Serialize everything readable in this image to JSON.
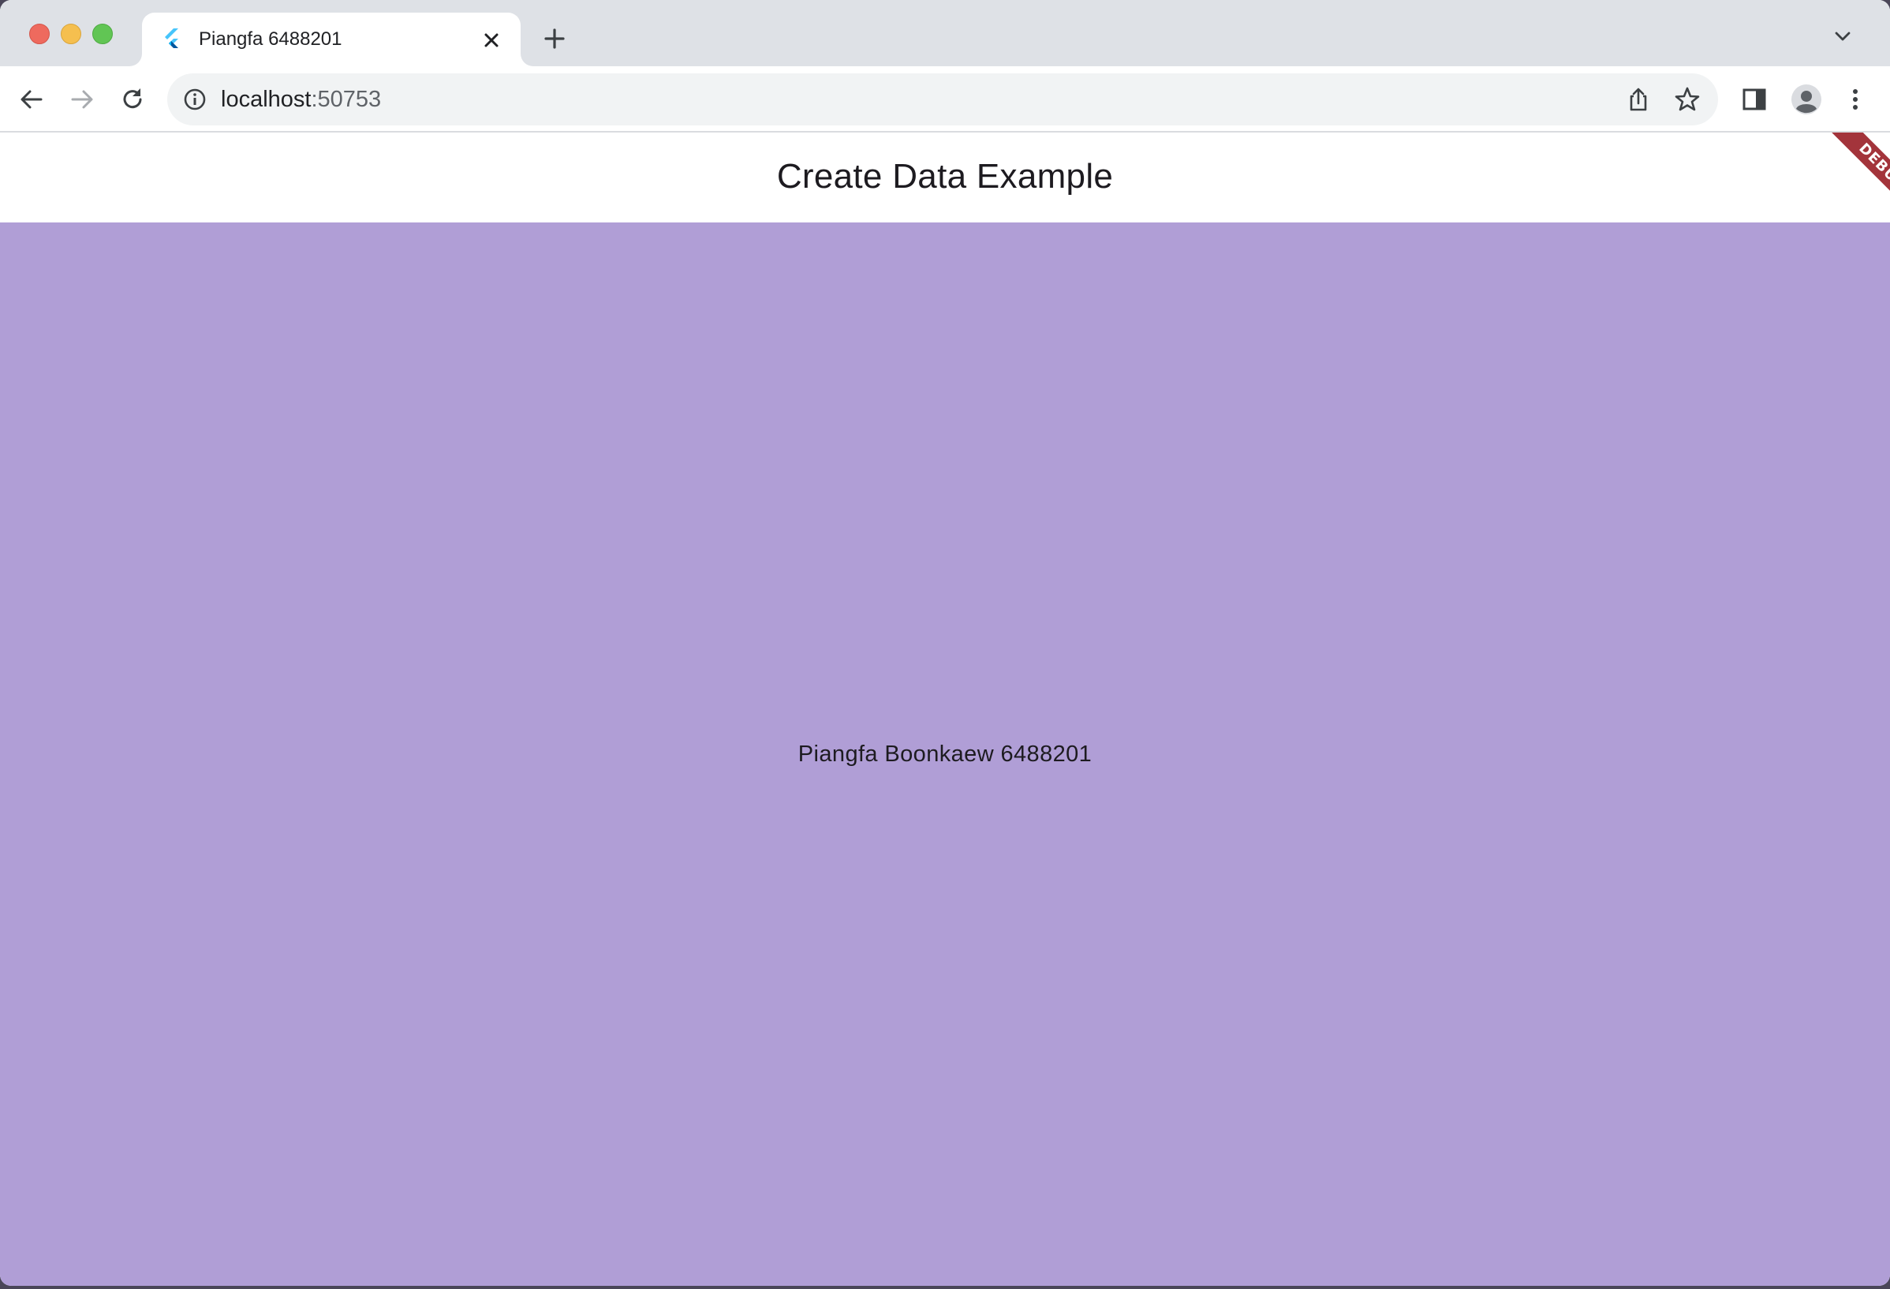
{
  "browser": {
    "tab": {
      "title": "Piangfa 6488201",
      "favicon": "flutter-logo-icon"
    },
    "url": {
      "host": "localhost",
      "port": ":50753"
    },
    "icons": {
      "back": "arrow-left-icon",
      "forward": "arrow-right-icon",
      "reload": "reload-icon",
      "site_info": "info-icon",
      "share": "share-icon",
      "bookmark": "star-icon",
      "side_panel": "side-panel-icon",
      "profile": "person-icon",
      "menu": "kebab-menu-icon",
      "new_tab": "plus-icon",
      "tab_search": "chevron-down-icon"
    }
  },
  "app": {
    "appbar_title": "Create Data Example",
    "body_text": "Piangfa Boonkaew 6488201",
    "debug_banner": "DEBUG",
    "colors": {
      "body_background": "#b09ed6",
      "appbar_background": "#ffffff",
      "debug_banner": "#a3343b"
    }
  }
}
